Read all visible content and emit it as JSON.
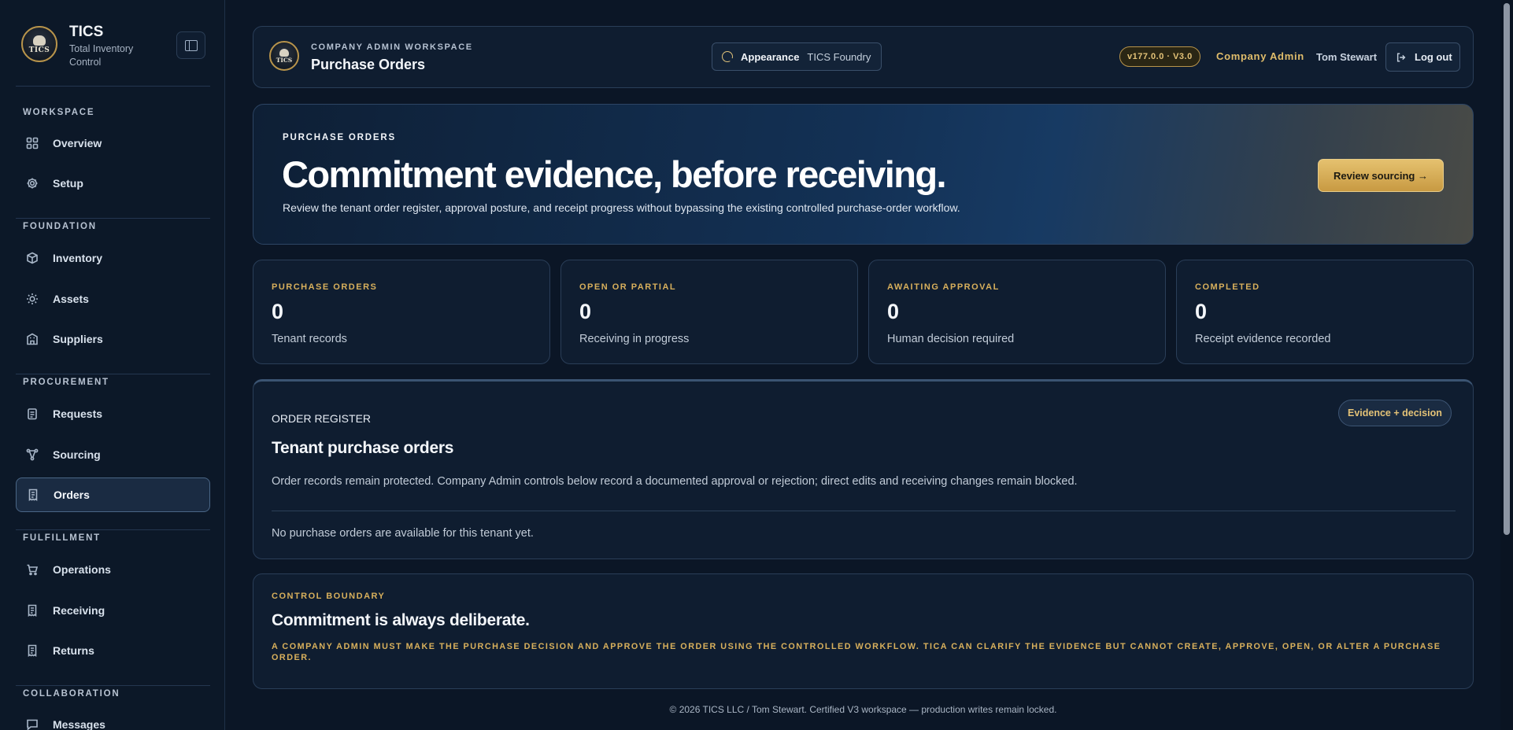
{
  "brand": {
    "name": "TICS",
    "subtitle": "Total Inventory Control",
    "logo_text": "TICS"
  },
  "sidebar": {
    "sections": [
      {
        "label": "WORKSPACE",
        "items": [
          {
            "label": "Overview",
            "icon": "grid-icon"
          },
          {
            "label": "Setup",
            "icon": "gear-icon"
          }
        ]
      },
      {
        "label": "FOUNDATION",
        "items": [
          {
            "label": "Inventory",
            "icon": "box-icon"
          },
          {
            "label": "Assets",
            "icon": "sun-icon"
          },
          {
            "label": "Suppliers",
            "icon": "building-icon"
          }
        ]
      },
      {
        "label": "PROCUREMENT",
        "items": [
          {
            "label": "Requests",
            "icon": "clipboard-icon"
          },
          {
            "label": "Sourcing",
            "icon": "network-icon"
          },
          {
            "label": "Orders",
            "icon": "receipt-icon",
            "active": true
          }
        ]
      },
      {
        "label": "FULFILLMENT",
        "items": [
          {
            "label": "Operations",
            "icon": "cart-icon"
          },
          {
            "label": "Receiving",
            "icon": "receipt-icon"
          },
          {
            "label": "Returns",
            "icon": "receipt-icon"
          }
        ]
      },
      {
        "label": "COLLABORATION",
        "items": [
          {
            "label": "Messages",
            "icon": "message-icon"
          }
        ]
      }
    ]
  },
  "topbar": {
    "workspace_label": "COMPANY ADMIN WORKSPACE",
    "page_title": "Purchase Orders",
    "appearance_label": "Appearance",
    "appearance_value": "TICS Foundry",
    "version": "v177.0.0 · V3.0",
    "role": "Company Admin",
    "user": "Tom Stewart",
    "logout_label": "Log out"
  },
  "hero": {
    "eyebrow": "PURCHASE ORDERS",
    "title": "Commitment evidence, before receiving.",
    "description": "Review the tenant order register, approval posture, and receipt progress without bypassing the existing controlled purchase-order workflow.",
    "cta_label": "Review sourcing →"
  },
  "stats": [
    {
      "label": "PURCHASE ORDERS",
      "value": "0",
      "sub": "Tenant records"
    },
    {
      "label": "OPEN OR PARTIAL",
      "value": "0",
      "sub": "Receiving in progress"
    },
    {
      "label": "AWAITING APPROVAL",
      "value": "0",
      "sub": "Human decision required"
    },
    {
      "label": "COMPLETED",
      "value": "0",
      "sub": "Receipt evidence recorded"
    }
  ],
  "register": {
    "eyebrow": "ORDER REGISTER",
    "title": "Tenant purchase orders",
    "pill": "Evidence + decision",
    "description": "Order records remain protected. Company Admin controls below record a documented approval or rejection; direct edits and receiving changes remain blocked.",
    "empty": "No purchase orders are available for this tenant yet."
  },
  "boundary": {
    "eyebrow": "CONTROL BOUNDARY",
    "title": "Commitment is always deliberate.",
    "text": "A company admin must make the purchase decision and approve the order using the controlled workflow. TICA can clarify the evidence but cannot create, approve, open, or alter a purchase order."
  },
  "footer": "© 2026 TICS LLC / Tom Stewart. Certified V3 workspace — production writes remain locked.",
  "colors": {
    "accent_gold": "#d8b05c",
    "background": "#0b1626",
    "panel": "#0f1d30"
  }
}
